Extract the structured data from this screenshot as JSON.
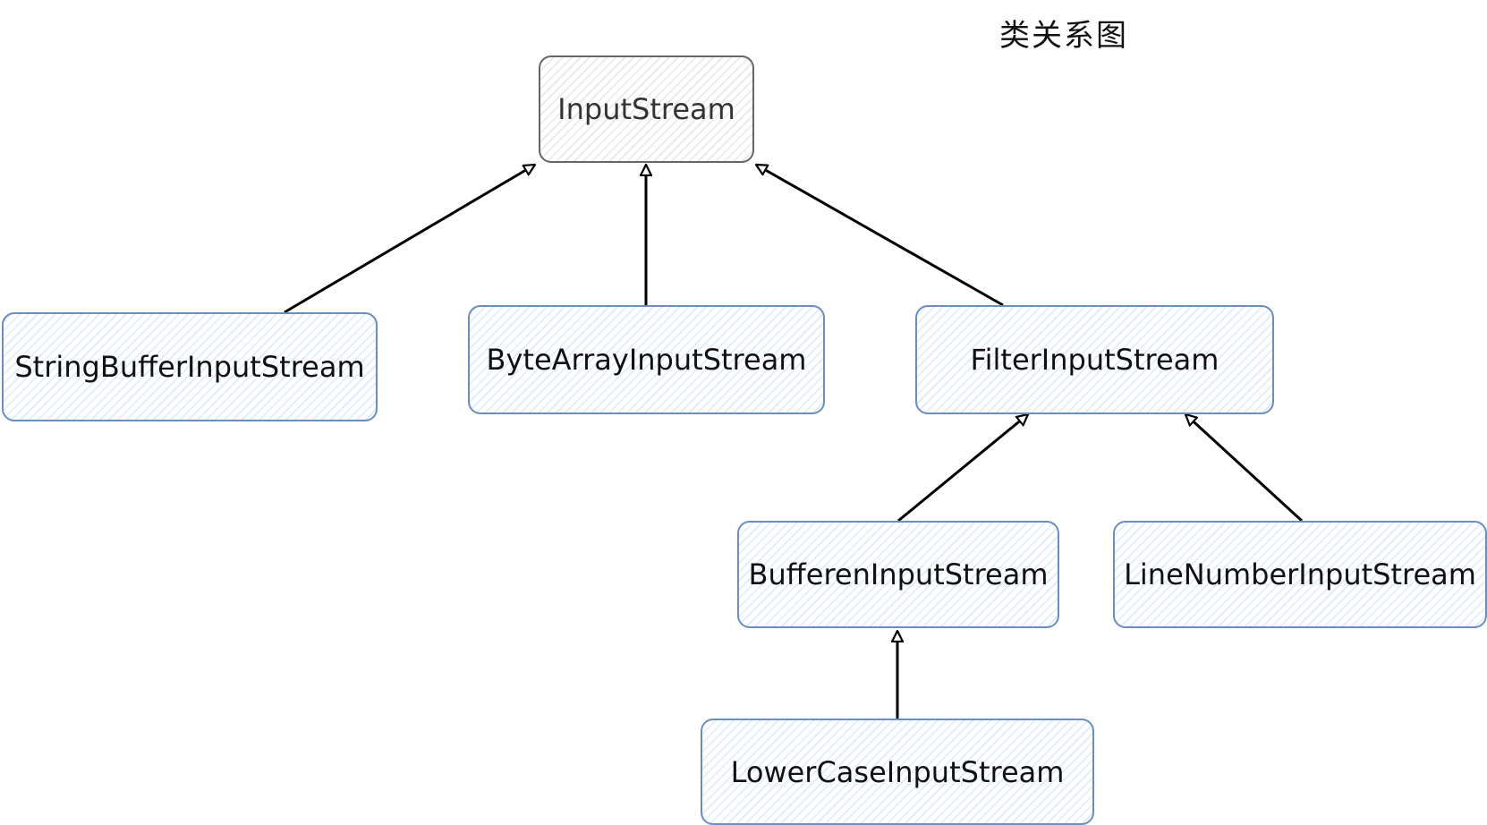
{
  "title": "类关系图",
  "colors": {
    "node_border": "#6c8ebf",
    "node_fill_hatch": "#dae8fc",
    "root_border": "#666666",
    "edge": "#000000"
  },
  "nodes": {
    "input_stream": "InputStream",
    "string_buffer_input_stream": "StringBufferInputStream",
    "byte_array_input_stream": "ByteArrayInputStream",
    "filter_input_stream": "FilterInputStream",
    "bufferen_input_stream": "BufferenInputStream",
    "line_number_input_stream": "LineNumberInputStream",
    "lower_case_input_stream": "LowerCaseInputStream"
  },
  "edges": [
    {
      "from": "string_buffer_input_stream",
      "to": "input_stream",
      "type": "inheritance"
    },
    {
      "from": "byte_array_input_stream",
      "to": "input_stream",
      "type": "inheritance"
    },
    {
      "from": "filter_input_stream",
      "to": "input_stream",
      "type": "inheritance"
    },
    {
      "from": "bufferen_input_stream",
      "to": "filter_input_stream",
      "type": "inheritance"
    },
    {
      "from": "line_number_input_stream",
      "to": "filter_input_stream",
      "type": "inheritance"
    },
    {
      "from": "lower_case_input_stream",
      "to": "bufferen_input_stream",
      "type": "inheritance"
    }
  ]
}
